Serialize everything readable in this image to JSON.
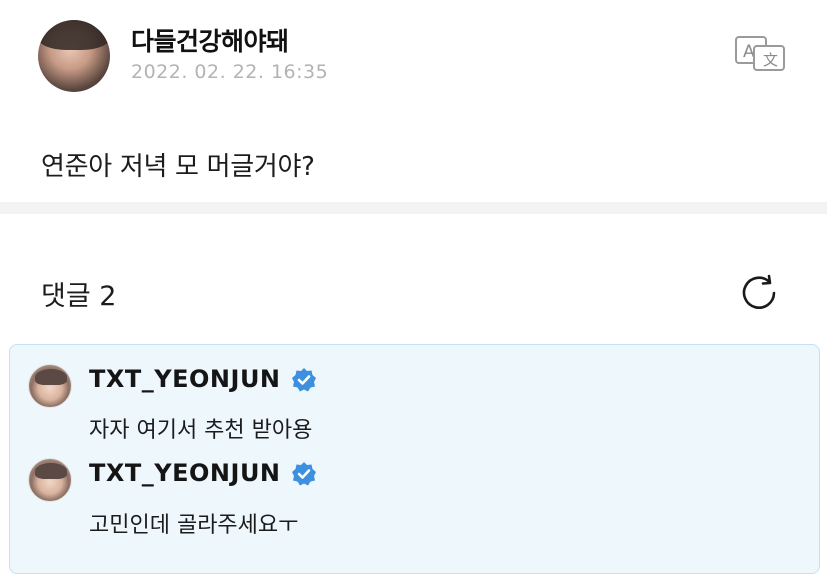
{
  "post": {
    "author": "다들건강해야돼",
    "date": "2022. 02. 22. 16:35",
    "body": "연준아 저녁 모 머글거야?"
  },
  "icons": {
    "translate": "translate-icon",
    "refresh": "refresh-icon",
    "verified": "verified-badge-icon"
  },
  "comments": {
    "header": "댓글 2",
    "items": [
      {
        "author": "TXT_YEONJUN",
        "verified": true,
        "text": "자자 여기서 추천 받아용"
      },
      {
        "author": "TXT_YEONJUN",
        "verified": true,
        "text": "고민인데 골라주세요ㅜ"
      }
    ]
  },
  "colors": {
    "verified_blue": "#3d8fe0",
    "comment_bg": "#eef7fc",
    "comment_border": "#c3e2f4",
    "date_gray": "#b3b3b3"
  }
}
